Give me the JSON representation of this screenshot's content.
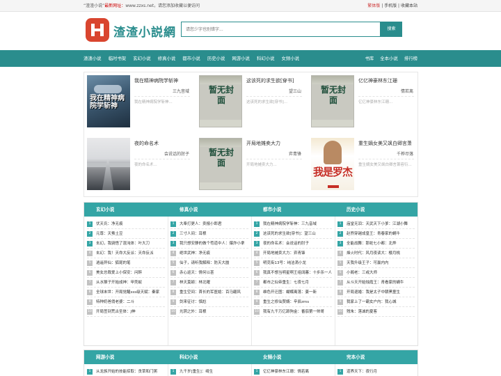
{
  "topbar": {
    "site_name": "“渣渣小说”",
    "latest_label": "最新网址：",
    "url_hint": "www.zzxs.net，请您添加收藏以便访问",
    "simplified": "繁体版",
    "sep1": " | ",
    "mobile": "手机版",
    "sep2": " | ",
    "bookmark": "收藏本站"
  },
  "header": {
    "logo_text": "渣渣小説網",
    "search_placeholder": "请您少字也别错字...",
    "search_button": "搜索"
  },
  "nav": {
    "main": [
      "渣渣小说",
      "临时书架",
      "玄幻小说",
      "修真小说",
      "都市小说",
      "历史小说",
      "网游小说",
      "科幻小说",
      "女频小说"
    ],
    "side": [
      "书库",
      "全本小说",
      "排行榜"
    ]
  },
  "featured": [
    {
      "title": "我在精神病院学斩神",
      "author": "三九音域",
      "intro": "我在精神病院学斩神...",
      "cover": "dark",
      "cover_text": "我在精神病院学斩神"
    },
    {
      "title": "这该死的求生欲[穿书]",
      "author": "望三山",
      "intro": "这该死的求生欲[穿书]...",
      "cover": "none",
      "cover_text": "暂无封面"
    },
    {
      "title": "亿亿神豪林东江珊",
      "author": "情若离",
      "intro": "亿亿神豪林东江珊...",
      "cover": "none",
      "cover_text": "暂无封面"
    },
    {
      "title": "夜的命名术",
      "author": "会说话的肘子",
      "intro": "夜的命名术...",
      "cover": "land",
      "cover_text": ""
    },
    {
      "title": "开局地摊卖大力",
      "author": "弈青锋",
      "intro": "开局地摊卖大力...",
      "cover": "none",
      "cover_text": "暂无封面"
    },
    {
      "title": "重生嫡女美又飒白卿言萧容衍",
      "author": "千桦尽落",
      "intro": "重生嫡女美又飒白卿言萧容衍...",
      "cover": "idol",
      "cover_text": "我是罗杰"
    }
  ],
  "categories_row1": [
    {
      "name": "玄幻小说",
      "items": [
        "伏天氏：净无痕",
        "元尊：天蚕土豆",
        "玄幻，我骑悟了混沌体：叶大刀",
        "玄幻：我！天命大反派：天命反派",
        "逍遥异仙：狐尾的笔",
        "美女总裁爱上小保安：问醉",
        "从水猴子开始成神：甲壳蚁",
        "全球末世：开局觉醒sss级天赋：秦家",
        "特种奶爸俏老婆：二斗",
        "开局签到荒古圣体：J神"
      ]
    },
    {
      "name": "修真小说",
      "items": [
        "大奉打更人：卖报小郎君",
        "三寸人间：耳根",
        "我只想安静的做个苟道中人：爆炸小拿",
        "绝世武神：净无痕",
        "仙子，请听我解释：防天大蜃",
        "赤心巡天：情何以甚",
        "林天莫颖：林北曜",
        "重生空间：首长的军医媳：百马翩风",
        "剑来征讨：慎尬",
        "光阴之外：耳根"
      ]
    },
    {
      "name": "都市小说",
      "items": [
        "我在精神病院学斩神：三九音域",
        "这该死的求生欲[穿书]：望三山",
        "夜的命名术：会说话的肘子",
        "开局地摊卖大力：弈青锋",
        "明克街13号：纯洁滴小龙",
        "我真不想当明星啊王组阔暮：十步杀一人",
        "都市之仙帝重生：七夜七月",
        "维色开迁图：蝴蝶离落：姜一新",
        "重生之修仙赘婿：辛辰zms",
        "我有九千万亿舔狗金：番茄第一帅哥"
      ]
    },
    {
      "name": "历史小说",
      "items": [
        "庙堂无泪：天武天下小爹：江湖小舞",
        "赵煦穿越成皇王：青春家的蜗牛",
        "全能战舞：那蛇七小都：北烨",
        "烽火时代：风月夜读大：樱月桃",
        "天我升级王子：可赢内内",
        "小阁老：三戒大师",
        "从斗天开始烛霞王：青看家的蜗牛",
        "开局退婚：我是太子中朝黑童生",
        "我家上了一霸女户内：我心城",
        "残朱：落诚的夏客"
      ]
    }
  ],
  "categories_row2": [
    {
      "name": "网游小说",
      "first": "从龙族开始的技能掠取：贪草和门粥"
    },
    {
      "name": "科幻小说",
      "first": "九千岁[重生]：绮生"
    },
    {
      "name": "女频小说",
      "first": "亿亿神豪林东江珊：情若离"
    },
    {
      "name": "完本小说",
      "first": "道界天下：夜行月"
    }
  ],
  "colors": {
    "teal": "#2a8d8d",
    "teal_light": "#34a5a5",
    "logo_red": "#d9452f",
    "accent_red": "#cc0000"
  }
}
